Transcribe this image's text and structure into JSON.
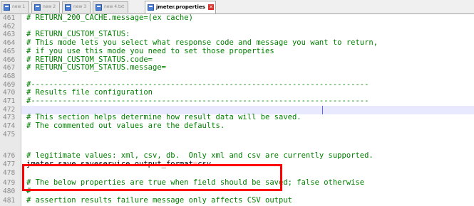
{
  "tabs": [
    {
      "label": "new 1",
      "active": false
    },
    {
      "label": "new 2",
      "active": false
    },
    {
      "label": "new 3",
      "active": false
    },
    {
      "label": "new 4.txt",
      "active": false
    },
    {
      "label": "jmeter.properties",
      "active": true
    }
  ],
  "colors": {
    "comment": "#008000",
    "line_number": "#8a8a8a",
    "highlight_box": "#ff0000"
  },
  "lines": [
    {
      "n": "461",
      "text": "# RETURN_200_CACHE.message=(ex cache)"
    },
    {
      "n": "462",
      "text": ""
    },
    {
      "n": "463",
      "text": "# RETURN_CUSTOM_STATUS:"
    },
    {
      "n": "464",
      "text": "# This mode lets you select what response code and message you want to return,"
    },
    {
      "n": "465",
      "text": "# if you use this mode you need to set those properties"
    },
    {
      "n": "466",
      "text": "# RETURN_CUSTOM_STATUS.code="
    },
    {
      "n": "467",
      "text": "# RETURN_CUSTOM_STATUS.message="
    },
    {
      "n": "468",
      "text": ""
    },
    {
      "n": "469",
      "text": "#---------------------------------------------------------------------------"
    },
    {
      "n": "470",
      "text": "# Results file configuration"
    },
    {
      "n": "471",
      "text": "#---------------------------------------------------------------------------"
    },
    {
      "n": "472",
      "text": ""
    },
    {
      "n": "473",
      "text": "# This section helps determine how result data will be saved."
    },
    {
      "n": "474",
      "text": "# The commented out values are the defaults."
    },
    {
      "n": "475",
      "text": ""
    },
    {
      "n": "476",
      "text": "# legitimate values: xml, csv, db.  Only xml and csv are currently supported."
    },
    {
      "n": "477",
      "key": "jmeter.save.saveservice.output_format",
      "op": "=",
      "value": "csv"
    },
    {
      "n": "478",
      "text": ""
    },
    {
      "n": "479",
      "text": "# The below properties are true when field should be saved; false otherwise"
    },
    {
      "n": "480",
      "text": "#"
    },
    {
      "n": "481",
      "text": "# assertion results failure message only affects CSV output"
    }
  ]
}
